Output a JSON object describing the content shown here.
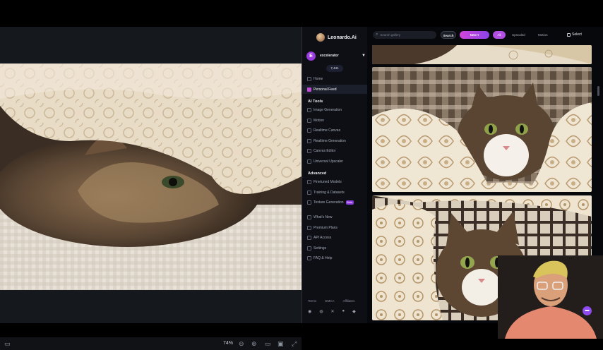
{
  "brand": {
    "name": "Leonardo.Ai"
  },
  "user": {
    "initial": "E",
    "name": "excelerator",
    "tokens": "7,441"
  },
  "nav": {
    "home": "Home",
    "personal_feed": "Personal Feed",
    "ai_tools_title": "AI Tools",
    "ai_tools": [
      "Image Generation",
      "Motion",
      "Realtime Canvas",
      "Realtime Generation",
      "Canvas Editor",
      "Universal Upscaler"
    ],
    "advanced_title": "Advanced",
    "advanced": [
      "Finetuned Models",
      "Training & Datasets",
      "Texture Generation"
    ],
    "beta_badge": "Beta",
    "other": [
      "What's New",
      "Premium Plans",
      "API Access",
      "Settings",
      "FAQ & Help"
    ]
  },
  "footer": {
    "links": [
      "Terms",
      "DMCA",
      "Affiliates"
    ]
  },
  "gallery": {
    "search_placeholder": "Search gallery",
    "search_button": "Search",
    "new_button": "New",
    "filters": [
      "All",
      "Upscaled",
      "Motion"
    ],
    "select_label": "Select"
  },
  "preview_toolbar": {
    "zoom": "74%"
  },
  "colors": {
    "accent": "#b04fe0",
    "sidebar_bg": "#0d0f14",
    "gallery_bg": "#07080b"
  }
}
